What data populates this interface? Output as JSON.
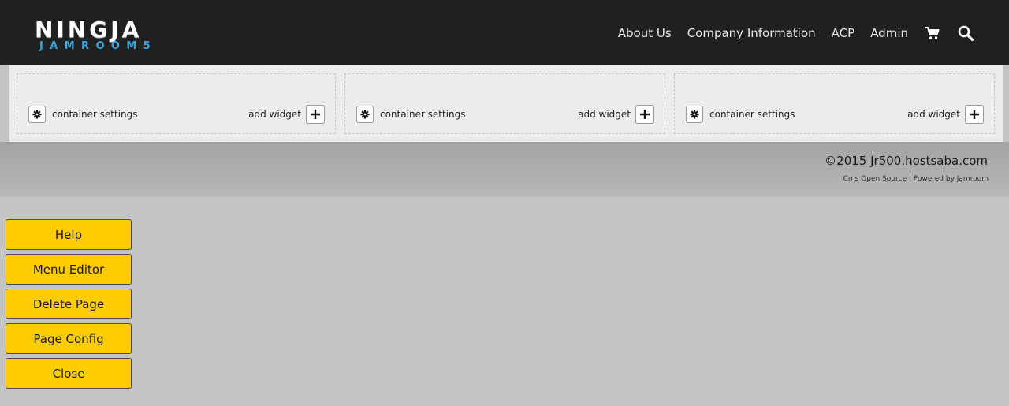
{
  "header": {
    "logo_main": "NINGJA",
    "logo_sub": "JAMROOM5",
    "nav": {
      "about": "About Us",
      "company": "Company Information",
      "acp": "ACP",
      "admin": "Admin"
    },
    "icons": [
      "cart-icon",
      "search-icon"
    ]
  },
  "containers": {
    "settings_label": "container settings",
    "add_widget_label": "add widget"
  },
  "footer": {
    "copyright": "©2015 Jr500.hostsaba.com",
    "powered": "Cms Open Source | Powered by Jamroom"
  },
  "side_buttons": {
    "help": "Help",
    "menu_editor": "Menu Editor",
    "delete_page": "Delete Page",
    "page_config": "Page Config",
    "close": "Close"
  },
  "colors": {
    "header_bg": "#202020",
    "button_yellow": "#ffcc00",
    "logo_accent": "#3aa3d8"
  }
}
